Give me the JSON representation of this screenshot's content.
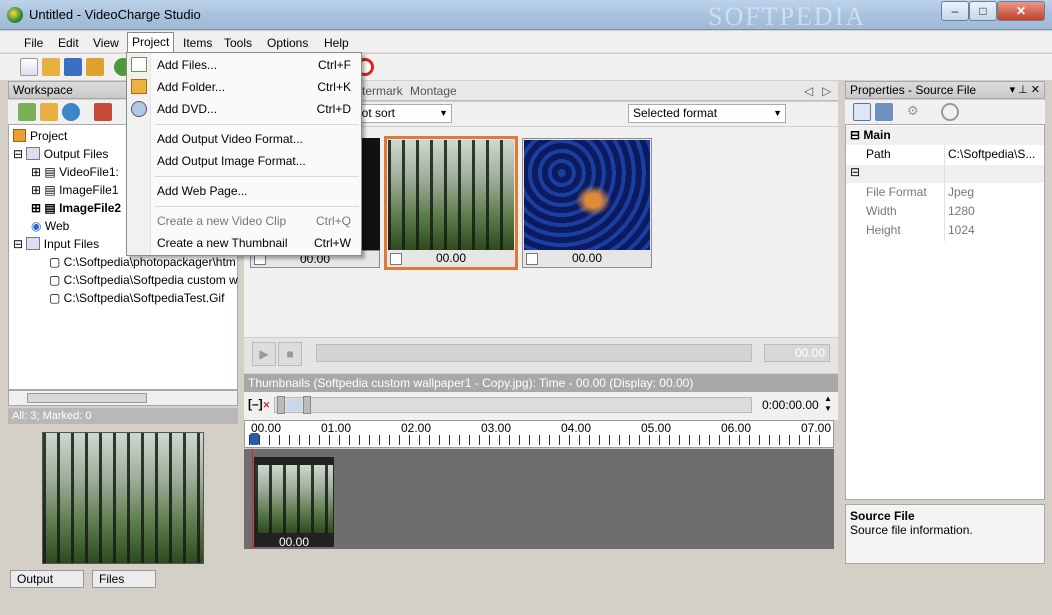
{
  "window": {
    "title": "Untitled - VideoCharge Studio",
    "watermark": "SOFTPEDIA",
    "min": "–",
    "max": "□",
    "close": "✕"
  },
  "menu": [
    "File",
    "Edit",
    "View",
    "Project",
    "Items",
    "Tools",
    "Options",
    "Help"
  ],
  "project_menu": {
    "items": [
      {
        "label": "Add Files...",
        "shortcut": "Ctrl+F",
        "enabled": true
      },
      {
        "label": "Add Folder...",
        "shortcut": "Ctrl+K",
        "enabled": true
      },
      {
        "label": "Add DVD...",
        "shortcut": "Ctrl+D",
        "enabled": true
      },
      {
        "label": "Add Output Video Format...",
        "shortcut": "",
        "enabled": true
      },
      {
        "label": "Add Output Image Format...",
        "shortcut": "",
        "enabled": true
      },
      {
        "label": "Add Web Page...",
        "shortcut": "",
        "enabled": true
      },
      {
        "label": "Create a new Video Clip",
        "shortcut": "Ctrl+Q",
        "enabled": false
      },
      {
        "label": "Create a new Thumbnail",
        "shortcut": "Ctrl+W",
        "enabled": true
      }
    ]
  },
  "workspace": {
    "title": "Workspace",
    "tree": {
      "project": "Project",
      "output_files": "Output Files",
      "outputs": [
        "VideoFile1:",
        "ImageFile1",
        "ImageFile2"
      ],
      "web": "Web",
      "input_files": "Input Files",
      "inputs": [
        "C:\\Softpedia\\photopackager\\htm",
        "C:\\Softpedia\\Softpedia custom w",
        "C:\\Softpedia\\SoftpediaTest.Gif"
      ]
    },
    "status": "All: 3; Marked: 0"
  },
  "center": {
    "tabs_visible": [
      "termark",
      "Montage"
    ],
    "sort_label": "not sort",
    "format_label": "Selected format",
    "thumbnails": [
      {
        "time": "00.00"
      },
      {
        "time": "00.00"
      },
      {
        "time": "00.00"
      }
    ],
    "player_time": "00.00"
  },
  "timeline": {
    "caption": "Thumbnails (Softpedia custom wallpaper1 - Copy.jpg): Time - 00.00 (Display: 00.00)",
    "time_value": "0:00:00.00",
    "ruler": [
      "00.00",
      "01.00",
      "02.00",
      "03.00",
      "04.00",
      "05.00",
      "06.00",
      "07.00"
    ],
    "clip_time": "00.00"
  },
  "properties": {
    "title": "Properties - Source File",
    "group_main": "Main",
    "rows": [
      {
        "name": "Path",
        "value": "C:\\Softpedia\\S..."
      },
      {
        "name": "File Format",
        "value": "Jpeg"
      },
      {
        "name": "Width",
        "value": "1280"
      },
      {
        "name": "Height",
        "value": "1024"
      }
    ],
    "desc_title": "Source File",
    "desc_text": "Source file information."
  },
  "bottom_tabs": [
    "Output",
    "Files"
  ]
}
